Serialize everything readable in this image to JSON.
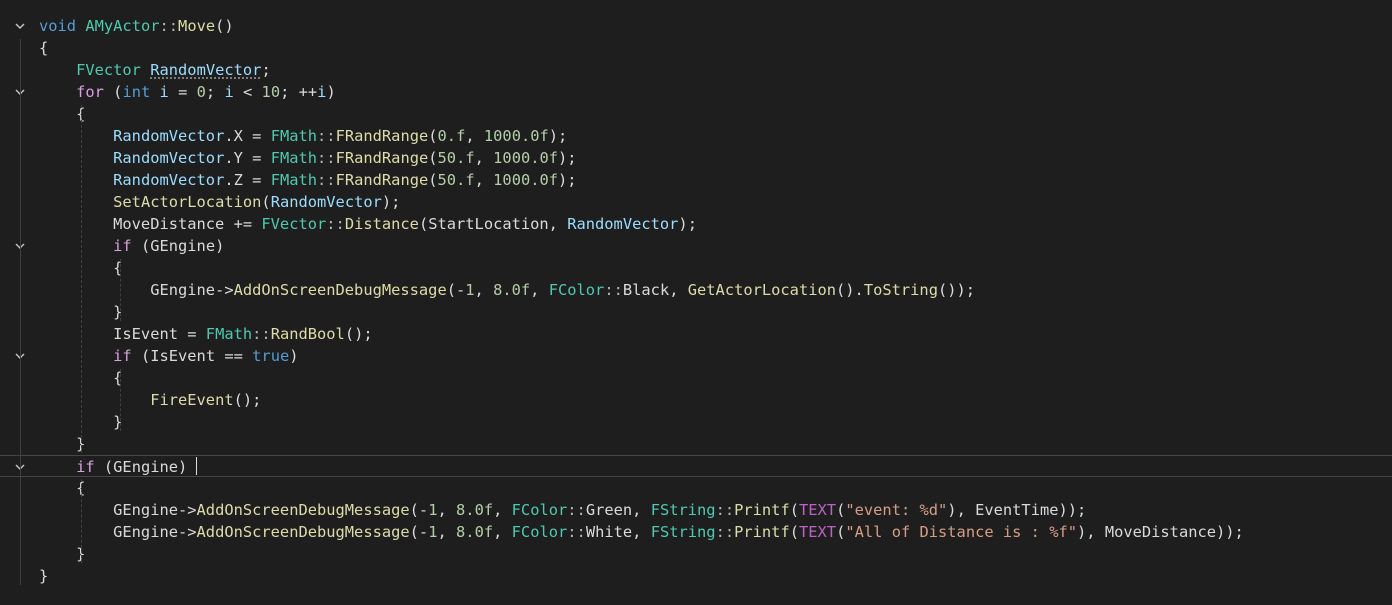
{
  "editor": {
    "title": "AMyActor::Move code editor",
    "colors": {
      "background": "#1e1e1e",
      "keyword": "#569cd6",
      "control": "#d8a0df",
      "type": "#4ec9b0",
      "function": "#dcdcaa",
      "variable": "#9cdcfe",
      "number": "#b5cea8",
      "string": "#d69d85",
      "macro": "#bd63c5",
      "plain": "#dadada"
    },
    "lines": [
      {
        "fold": true,
        "tokens": [
          [
            "kw",
            "void"
          ],
          [
            "plain",
            " "
          ],
          [
            "type",
            "AMyActor"
          ],
          [
            "op",
            "::"
          ],
          [
            "fn",
            "Move"
          ],
          [
            "plain",
            "()"
          ]
        ]
      },
      {
        "fold": false,
        "tokens": [
          [
            "plain",
            "{"
          ]
        ]
      },
      {
        "fold": false,
        "tokens": [
          [
            "plain",
            "    "
          ],
          [
            "type",
            "FVector"
          ],
          [
            "plain",
            " "
          ],
          [
            "var",
            "RandomVector"
          ],
          [
            "plain",
            ";"
          ]
        ]
      },
      {
        "fold": true,
        "tokens": [
          [
            "plain",
            "    "
          ],
          [
            "ctrl",
            "for"
          ],
          [
            "plain",
            " ("
          ],
          [
            "kw",
            "int"
          ],
          [
            "plain",
            " "
          ],
          [
            "var",
            "i"
          ],
          [
            "plain",
            " = "
          ],
          [
            "num",
            "0"
          ],
          [
            "plain",
            "; "
          ],
          [
            "var",
            "i"
          ],
          [
            "plain",
            " < "
          ],
          [
            "num",
            "10"
          ],
          [
            "plain",
            "; ++"
          ],
          [
            "var",
            "i"
          ],
          [
            "plain",
            ")"
          ]
        ]
      },
      {
        "fold": false,
        "tokens": [
          [
            "plain",
            "    {"
          ]
        ]
      },
      {
        "fold": false,
        "tokens": [
          [
            "plain",
            "        "
          ],
          [
            "var",
            "RandomVector"
          ],
          [
            "plain",
            ".X = "
          ],
          [
            "type",
            "FMath"
          ],
          [
            "op",
            "::"
          ],
          [
            "fn",
            "FRandRange"
          ],
          [
            "plain",
            "("
          ],
          [
            "num",
            "0.f"
          ],
          [
            "plain",
            ", "
          ],
          [
            "num",
            "1000.0f"
          ],
          [
            "plain",
            ");"
          ]
        ]
      },
      {
        "fold": false,
        "tokens": [
          [
            "plain",
            "        "
          ],
          [
            "var",
            "RandomVector"
          ],
          [
            "plain",
            ".Y = "
          ],
          [
            "type",
            "FMath"
          ],
          [
            "op",
            "::"
          ],
          [
            "fn",
            "FRandRange"
          ],
          [
            "plain",
            "("
          ],
          [
            "num",
            "50.f"
          ],
          [
            "plain",
            ", "
          ],
          [
            "num",
            "1000.0f"
          ],
          [
            "plain",
            ");"
          ]
        ]
      },
      {
        "fold": false,
        "tokens": [
          [
            "plain",
            "        "
          ],
          [
            "var",
            "RandomVector"
          ],
          [
            "plain",
            ".Z = "
          ],
          [
            "type",
            "FMath"
          ],
          [
            "op",
            "::"
          ],
          [
            "fn",
            "FRandRange"
          ],
          [
            "plain",
            "("
          ],
          [
            "num",
            "50.f"
          ],
          [
            "plain",
            ", "
          ],
          [
            "num",
            "1000.0f"
          ],
          [
            "plain",
            ");"
          ]
        ]
      },
      {
        "fold": false,
        "tokens": [
          [
            "plain",
            "        "
          ],
          [
            "fn",
            "SetActorLocation"
          ],
          [
            "plain",
            "("
          ],
          [
            "var",
            "RandomVector"
          ],
          [
            "plain",
            ");"
          ]
        ]
      },
      {
        "fold": false,
        "tokens": [
          [
            "plain",
            "        MoveDistance += "
          ],
          [
            "type",
            "FVector"
          ],
          [
            "op",
            "::"
          ],
          [
            "fn",
            "Distance"
          ],
          [
            "plain",
            "(StartLocation, "
          ],
          [
            "var",
            "RandomVector"
          ],
          [
            "plain",
            ");"
          ]
        ]
      },
      {
        "fold": true,
        "tokens": [
          [
            "plain",
            "        "
          ],
          [
            "ctrl",
            "if"
          ],
          [
            "plain",
            " (GEngine)"
          ]
        ]
      },
      {
        "fold": false,
        "tokens": [
          [
            "plain",
            "        {"
          ]
        ]
      },
      {
        "fold": false,
        "tokens": [
          [
            "plain",
            "            GEngine->"
          ],
          [
            "fn",
            "AddOnScreenDebugMessage"
          ],
          [
            "plain",
            "(-"
          ],
          [
            "num",
            "1"
          ],
          [
            "plain",
            ", "
          ],
          [
            "num",
            "8.0f"
          ],
          [
            "plain",
            ", "
          ],
          [
            "type",
            "FColor"
          ],
          [
            "op",
            "::"
          ],
          [
            "plain",
            "Black, "
          ],
          [
            "fn",
            "GetActorLocation"
          ],
          [
            "plain",
            "()."
          ],
          [
            "fn",
            "ToString"
          ],
          [
            "plain",
            "());"
          ]
        ]
      },
      {
        "fold": false,
        "tokens": [
          [
            "plain",
            "        }"
          ]
        ]
      },
      {
        "fold": false,
        "tokens": [
          [
            "plain",
            "        IsEvent = "
          ],
          [
            "type",
            "FMath"
          ],
          [
            "op",
            "::"
          ],
          [
            "fn",
            "RandBool"
          ],
          [
            "plain",
            "();"
          ]
        ]
      },
      {
        "fold": true,
        "tokens": [
          [
            "plain",
            "        "
          ],
          [
            "ctrl",
            "if"
          ],
          [
            "plain",
            " (IsEvent == "
          ],
          [
            "kw",
            "true"
          ],
          [
            "plain",
            ")"
          ]
        ]
      },
      {
        "fold": false,
        "tokens": [
          [
            "plain",
            "        {"
          ]
        ]
      },
      {
        "fold": false,
        "tokens": [
          [
            "plain",
            "            "
          ],
          [
            "fn",
            "FireEvent"
          ],
          [
            "plain",
            "();"
          ]
        ]
      },
      {
        "fold": false,
        "tokens": [
          [
            "plain",
            "        }"
          ]
        ]
      },
      {
        "fold": false,
        "tokens": [
          [
            "plain",
            "    }"
          ]
        ]
      },
      {
        "fold": true,
        "tokens": [
          [
            "plain",
            "    "
          ],
          [
            "ctrl",
            "if"
          ],
          [
            "plain",
            " (GEngine)"
          ]
        ]
      },
      {
        "fold": false,
        "tokens": [
          [
            "plain",
            "    {"
          ]
        ]
      },
      {
        "fold": false,
        "tokens": [
          [
            "plain",
            "        GEngine->"
          ],
          [
            "fn",
            "AddOnScreenDebugMessage"
          ],
          [
            "plain",
            "(-"
          ],
          [
            "num",
            "1"
          ],
          [
            "plain",
            ", "
          ],
          [
            "num",
            "8.0f"
          ],
          [
            "plain",
            ", "
          ],
          [
            "type",
            "FColor"
          ],
          [
            "op",
            "::"
          ],
          [
            "plain",
            "Green, "
          ],
          [
            "type",
            "FString"
          ],
          [
            "op",
            "::"
          ],
          [
            "fn",
            "Printf"
          ],
          [
            "plain",
            "("
          ],
          [
            "macro",
            "TEXT"
          ],
          [
            "plain",
            "("
          ],
          [
            "str",
            "\"event: %d\""
          ],
          [
            "plain",
            "), EventTime));"
          ]
        ]
      },
      {
        "fold": false,
        "tokens": [
          [
            "plain",
            "        GEngine->"
          ],
          [
            "fn",
            "AddOnScreenDebugMessage"
          ],
          [
            "plain",
            "(-"
          ],
          [
            "num",
            "1"
          ],
          [
            "plain",
            ", "
          ],
          [
            "num",
            "8.0f"
          ],
          [
            "plain",
            ", "
          ],
          [
            "type",
            "FColor"
          ],
          [
            "op",
            "::"
          ],
          [
            "plain",
            "White, "
          ],
          [
            "type",
            "FString"
          ],
          [
            "op",
            "::"
          ],
          [
            "fn",
            "Printf"
          ],
          [
            "plain",
            "("
          ],
          [
            "macro",
            "TEXT"
          ],
          [
            "plain",
            "("
          ],
          [
            "str",
            "\"All of Distance is : %f\""
          ],
          [
            "plain",
            "), MoveDistance));"
          ]
        ]
      },
      {
        "fold": false,
        "tokens": [
          [
            "plain",
            "    }"
          ]
        ]
      },
      {
        "fold": false,
        "tokens": [
          [
            "plain",
            "}"
          ]
        ]
      }
    ],
    "current_line": 20
  }
}
